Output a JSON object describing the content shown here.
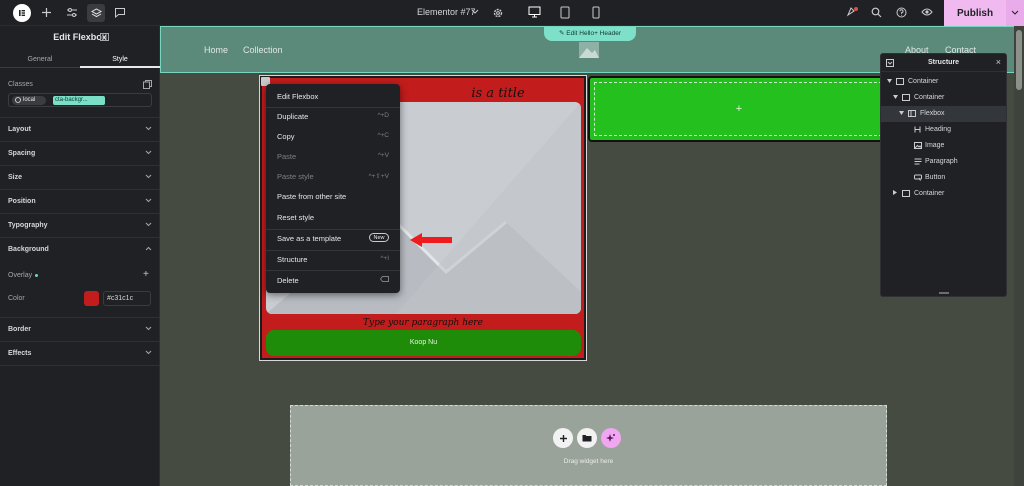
{
  "topbar": {
    "document_title": "Elementor #77",
    "publish_label": "Publish"
  },
  "panel": {
    "title": "Edit Flexbox",
    "tabs": [
      "General",
      "Style"
    ],
    "classes_label": "Classes",
    "class_chips": [
      "local",
      "cta-backgr..."
    ],
    "sections": [
      "Layout",
      "Spacing",
      "Size",
      "Position",
      "Typography",
      "Background",
      "Border",
      "Effects"
    ],
    "overlay_label": "Overlay",
    "color_label": "Color",
    "color_value": "#c31c1c",
    "color_swatch": "#c31c1c"
  },
  "canvas": {
    "nav_left": [
      "Home",
      "Collection"
    ],
    "nav_right": [
      "About",
      "Contact"
    ],
    "edit_header_label": "Edit Hello+ Header",
    "heading": "is a title",
    "paragraph": "Type your paragraph here",
    "button_label": "Koop Nu",
    "dropzone_text": "Drag widget here"
  },
  "context_menu": {
    "items": [
      {
        "label": "Edit Flexbox",
        "shortcut": ""
      },
      {
        "label": "Duplicate",
        "shortcut": "^+D"
      },
      {
        "label": "Copy",
        "shortcut": "^+C"
      },
      {
        "label": "Paste",
        "shortcut": "^+V"
      },
      {
        "label": "Paste style",
        "shortcut": "^+⇧+V"
      },
      {
        "label": "Paste from other site",
        "shortcut": ""
      },
      {
        "label": "Reset style",
        "shortcut": ""
      },
      {
        "label": "Save as a template",
        "shortcut": ""
      },
      {
        "label": "Structure",
        "shortcut": "^+I"
      },
      {
        "label": "Delete",
        "shortcut": ""
      }
    ],
    "new_badge": "New"
  },
  "structure": {
    "title": "Structure",
    "rows": [
      {
        "label": "Container"
      },
      {
        "label": "Container"
      },
      {
        "label": "Flexbox"
      },
      {
        "label": "Heading"
      },
      {
        "label": "Image"
      },
      {
        "label": "Paragraph"
      },
      {
        "label": "Button"
      },
      {
        "label": "Container"
      }
    ]
  },
  "colors": {
    "accent_green": "#23c01e",
    "flexbox_red": "#c31c1c",
    "publish_pink": "#f0b9f0",
    "header_teal": "#5c8a7a"
  }
}
